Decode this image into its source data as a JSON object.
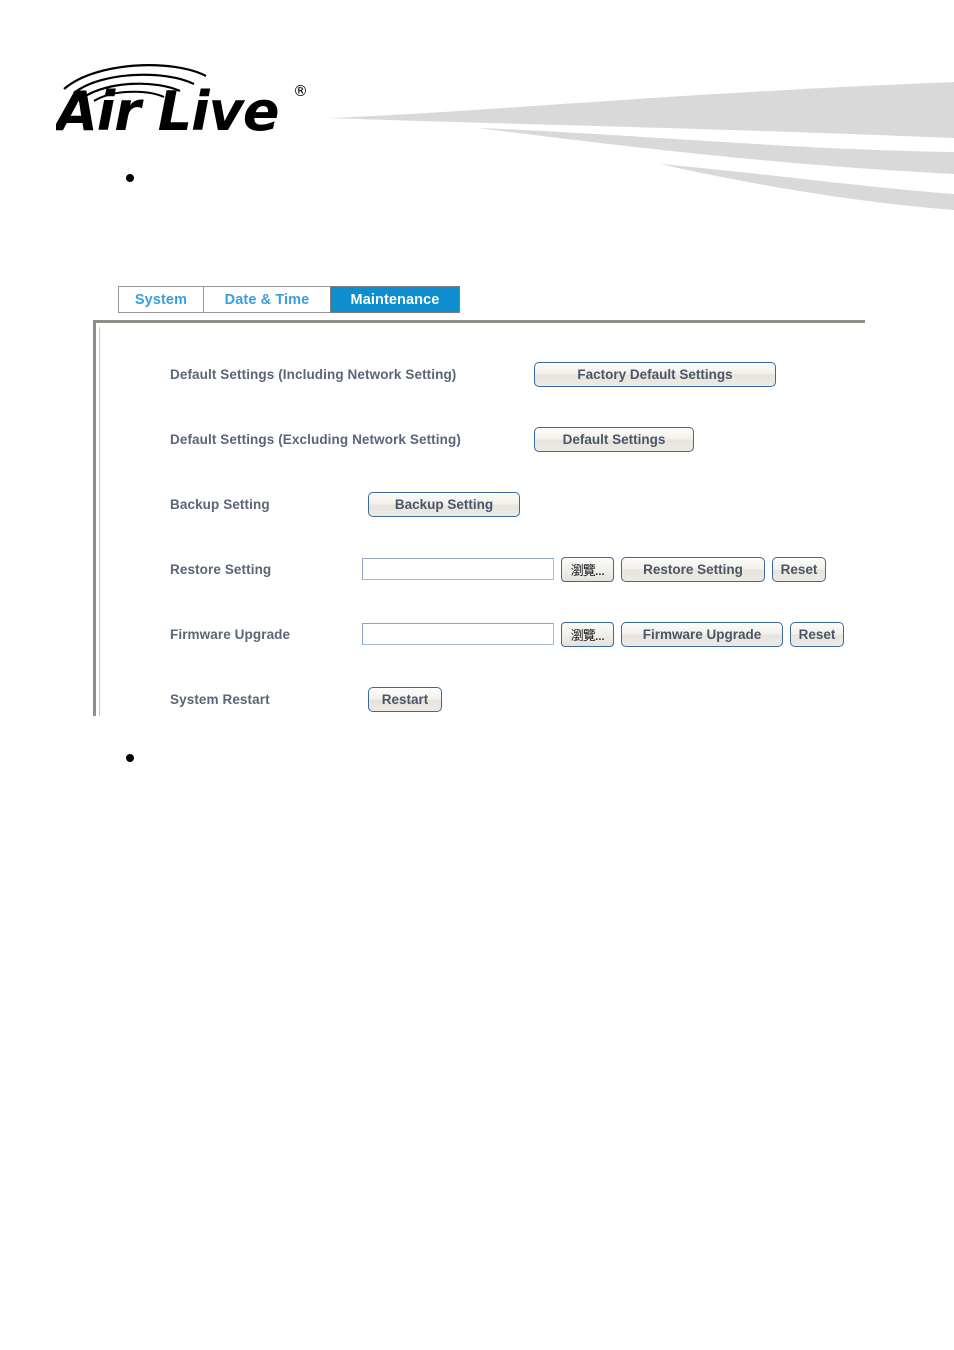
{
  "brand": {
    "name": "Air Live",
    "trademark": "®"
  },
  "bullets": {
    "top": "",
    "bottom": ""
  },
  "tabs": [
    {
      "id": "system",
      "label": "System",
      "active": false
    },
    {
      "id": "datetime",
      "label": "Date & Time",
      "active": false
    },
    {
      "id": "maintenance",
      "label": "Maintenance",
      "active": true
    }
  ],
  "browse_button_label": "瀏覽...",
  "rows": [
    {
      "id": "default-including-network",
      "label": "Default Settings (Including Network Setting)",
      "button": "Factory Default Settings"
    },
    {
      "id": "default-excluding-network",
      "label": "Default Settings (Excluding Network Setting)",
      "button": "Default Settings"
    },
    {
      "id": "backup-setting",
      "label": "Backup Setting",
      "button": "Backup Setting"
    },
    {
      "id": "restore-setting",
      "label": "Restore Setting",
      "field_value": "",
      "field_placeholder": "",
      "browse": "瀏覽...",
      "button": "Restore Setting",
      "reset": "Reset"
    },
    {
      "id": "firmware-upgrade",
      "label": "Firmware Upgrade",
      "field_value": "",
      "field_placeholder": "",
      "browse": "瀏覽...",
      "button": "Firmware Upgrade",
      "reset": "Reset"
    },
    {
      "id": "system-restart",
      "label": "System Restart",
      "button": "Restart"
    }
  ],
  "colors": {
    "tab_active_bg": "#0f8ecf",
    "tab_inactive_text": "#3a9fd8",
    "label_text": "#5a6578",
    "button_border": "#3a6a9a",
    "panel_border": "#8f8f86",
    "swoosh": "#d9d9d9"
  }
}
